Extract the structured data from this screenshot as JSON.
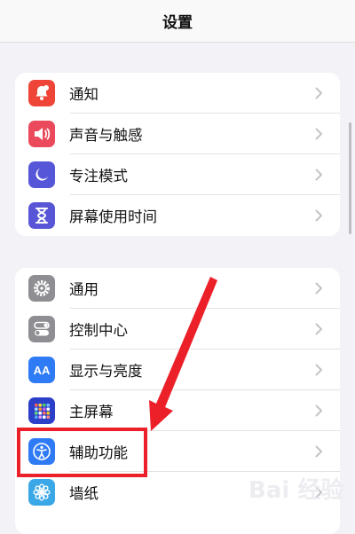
{
  "nav": {
    "title": "设置"
  },
  "groups": [
    {
      "items": [
        {
          "label": "通知",
          "icon": "bell-icon",
          "color": "#ee4538"
        },
        {
          "label": "声音与触感",
          "icon": "speaker-icon",
          "color": "#ea4a5b"
        },
        {
          "label": "专注模式",
          "icon": "moon-icon",
          "color": "#5656d8"
        },
        {
          "label": "屏幕使用时间",
          "icon": "hourglass-icon",
          "color": "#5856d6"
        }
      ]
    },
    {
      "items": [
        {
          "label": "通用",
          "icon": "gear-icon",
          "color": "#8e8e93"
        },
        {
          "label": "控制中心",
          "icon": "toggles-icon",
          "color": "#8e8e93"
        },
        {
          "label": "显示与亮度",
          "icon": "aa-icon",
          "color": "#2f7bf5",
          "icon_text": "AA"
        },
        {
          "label": "主屏幕",
          "icon": "home-grid-icon",
          "color": "#2c3fc9"
        },
        {
          "label": "辅助功能",
          "icon": "accessibility-icon",
          "color": "#2f7bf5"
        },
        {
          "label": "墙纸",
          "icon": "flower-icon",
          "color": "#3aa8e6"
        }
      ]
    }
  ],
  "annotation": {
    "highlight_color": "#ec2029"
  },
  "watermark": {
    "text": "Bai 经验"
  }
}
